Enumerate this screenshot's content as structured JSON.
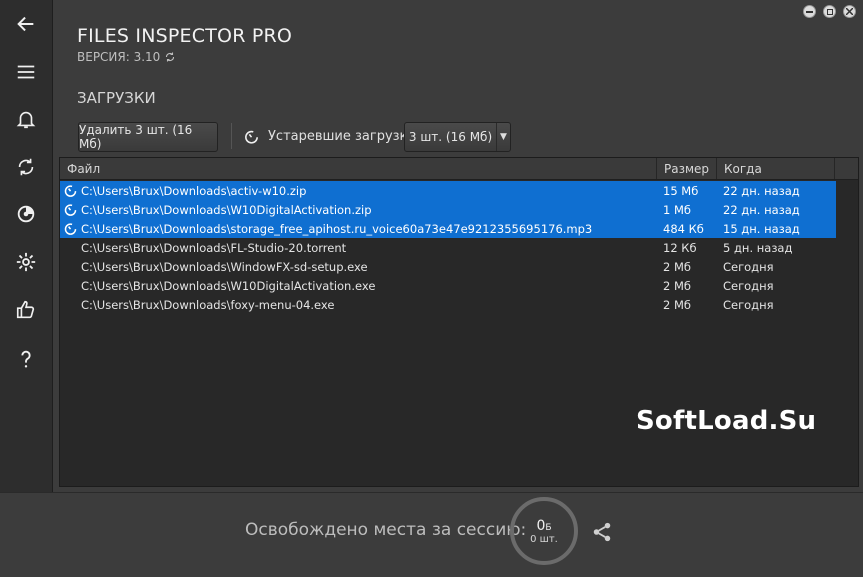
{
  "app": {
    "title": "FILES INSPECTOR PRO",
    "version": "ВЕРСИЯ: 3.10"
  },
  "sidebar": {
    "items": [
      {
        "icon": "back-arrow-icon"
      },
      {
        "icon": "menu-icon"
      },
      {
        "icon": "bell-icon"
      },
      {
        "icon": "refresh-icon"
      },
      {
        "icon": "disk-cleanup-icon"
      },
      {
        "icon": "gear-icon"
      },
      {
        "icon": "thumbs-up-icon"
      },
      {
        "icon": "help-icon"
      }
    ]
  },
  "section": {
    "title": "ЗАГРУЗКИ"
  },
  "toolbar": {
    "delete_label": "Удалить 3 шт. (16 Мб)",
    "stale_label": "Устаревшие загрузки:",
    "stale_select_value": "3 шт. (16 Мб)"
  },
  "table": {
    "headers": {
      "file": "Файл",
      "size": "Размер",
      "when": "Когда"
    },
    "rows": [
      {
        "path": "C:\\Users\\Brux\\Downloads\\activ-w10.zip",
        "size": "15 Мб",
        "when": "22 дн. назад",
        "selected": true
      },
      {
        "path": "C:\\Users\\Brux\\Downloads\\W10DigitalActivation.zip",
        "size": "1 Мб",
        "when": "22 дн. назад",
        "selected": true
      },
      {
        "path": "C:\\Users\\Brux\\Downloads\\storage_free_apihost.ru_voice60a73e47e9212355695176.mp3",
        "size": "484 Кб",
        "when": "15 дн. назад",
        "selected": true
      },
      {
        "path": "C:\\Users\\Brux\\Downloads\\FL-Studio-20.torrent",
        "size": "12 Кб",
        "when": "5 дн. назад",
        "selected": false
      },
      {
        "path": "C:\\Users\\Brux\\Downloads\\WindowFX-sd-setup.exe",
        "size": "2 Мб",
        "when": "Сегодня",
        "selected": false
      },
      {
        "path": "C:\\Users\\Brux\\Downloads\\W10DigitalActivation.exe",
        "size": "2 Мб",
        "when": "Сегодня",
        "selected": false
      },
      {
        "path": "C:\\Users\\Brux\\Downloads\\foxy-menu-04.exe",
        "size": "2 Мб",
        "when": "Сегодня",
        "selected": false
      }
    ]
  },
  "watermark": "SoftLoad.Su",
  "footer": {
    "freed_label": "Освобождено места за сессию:",
    "freed_value": "0",
    "freed_unit": "Б",
    "freed_count": "0 шт."
  },
  "colors": {
    "background": "#3c3c3c",
    "sidebar": "#2d2d2d",
    "selection": "#0f6fd1"
  }
}
